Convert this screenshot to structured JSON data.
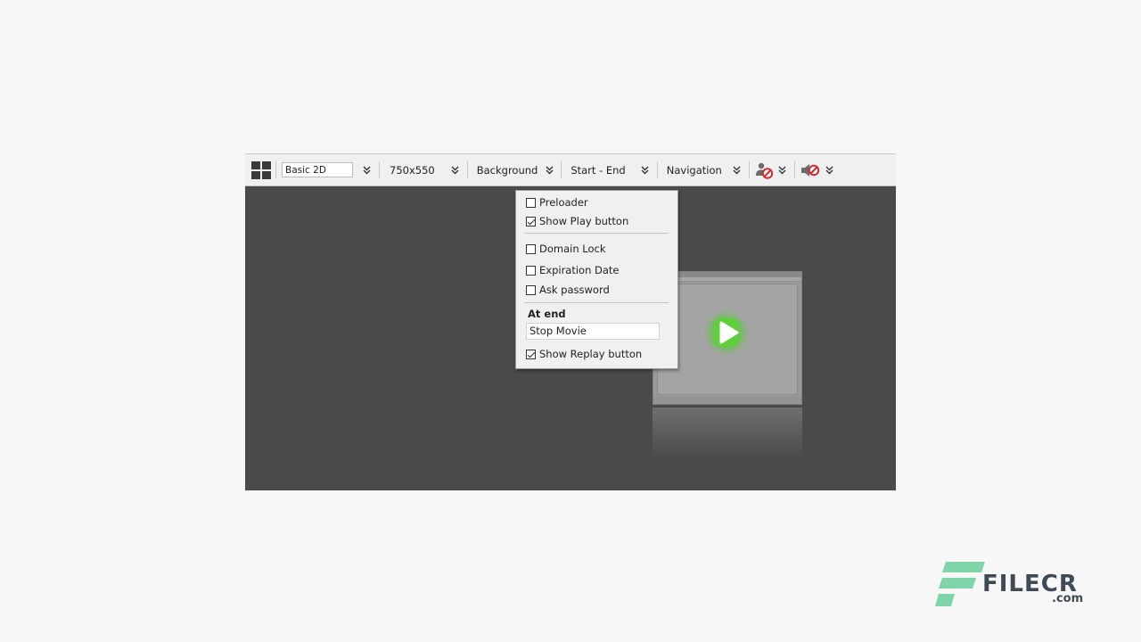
{
  "toolbar": {
    "preset_value": "Basic 2D",
    "size_label": "750x550",
    "background_label": "Background",
    "range_label": "Start - End",
    "navigation_label": "Navigation"
  },
  "dropdown": {
    "items_top": [
      {
        "label": "Preloader",
        "checked": false
      },
      {
        "label": "Show Play button",
        "checked": true
      }
    ],
    "items_security": [
      {
        "label": "Domain Lock",
        "checked": false
      },
      {
        "label": "Expiration Date",
        "checked": false
      },
      {
        "label": "Ask password",
        "checked": false
      }
    ],
    "at_end_title": "At end",
    "at_end_value": "Stop Movie",
    "show_replay": {
      "label": "Show Replay button",
      "checked": true
    }
  },
  "watermark": {
    "text": "FILECR",
    "suffix": ".com"
  },
  "colors": {
    "stage_bg": "#4a4a4a",
    "toolbar_bg": "#f0f0f0",
    "play_green": "#5fcf3a",
    "block_red": "#d22b2b",
    "watermark_green": "#7fd4a8"
  },
  "icons": [
    "layout-grid-icon",
    "chevron-double-down-icon",
    "user-blocked-icon",
    "sound-muted-icon",
    "play-icon"
  ]
}
